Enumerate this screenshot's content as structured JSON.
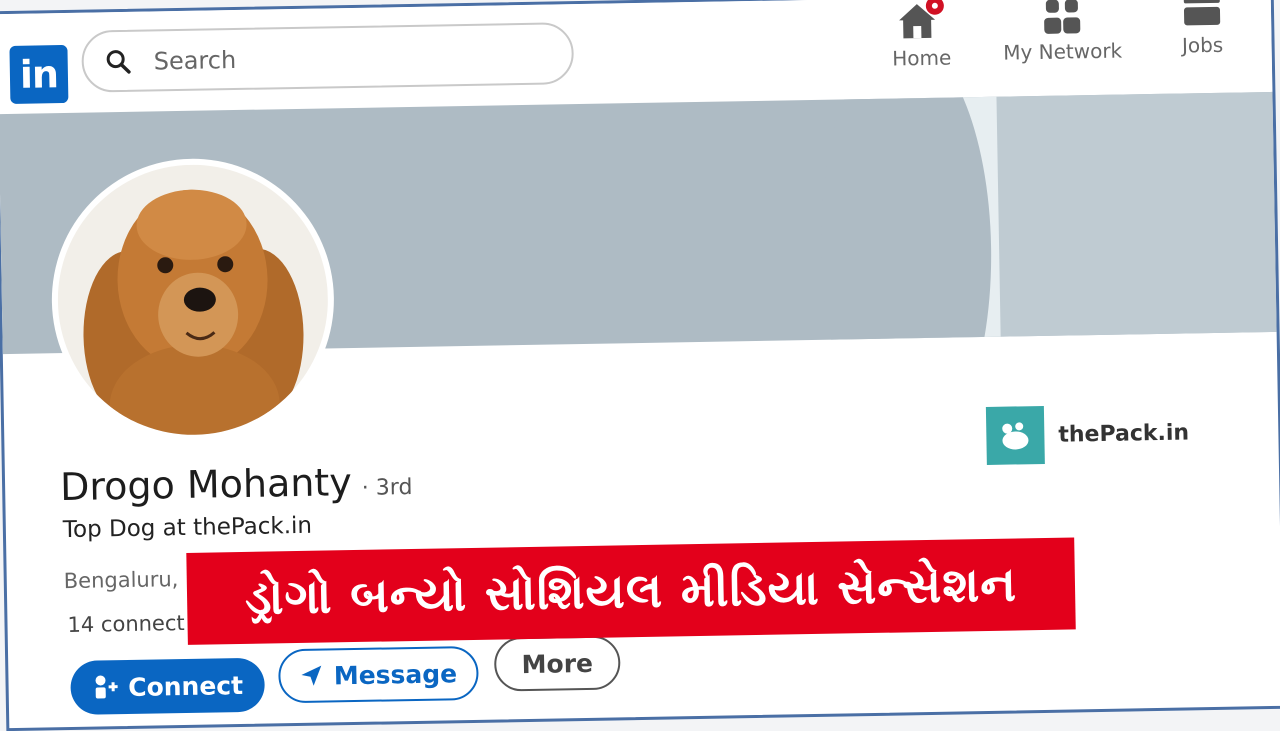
{
  "logo": {
    "text": "in",
    "color": "#0a66c2"
  },
  "search": {
    "placeholder": "Search",
    "icon": "search-icon"
  },
  "nav": [
    {
      "label": "Home",
      "icon": "home-icon"
    },
    {
      "label": "My Network",
      "icon": "network-icon"
    },
    {
      "label": "Jobs",
      "icon": "briefcase-icon"
    }
  ],
  "profile": {
    "name": "Drogo Mohanty",
    "degree": "· 3rd",
    "headline": "Top Dog at thePack.in",
    "location": "Bengaluru,",
    "connections": "14 connect"
  },
  "company": {
    "name": "thePack.in",
    "color": "#3aa8a8"
  },
  "buttons": {
    "connect": "Connect",
    "message": "Message",
    "more": "More"
  },
  "caption": {
    "text": "ડ્રોગો બન્યો સોશિયલ મીડિયા સેન્સેશન",
    "color": "#e3001b"
  }
}
